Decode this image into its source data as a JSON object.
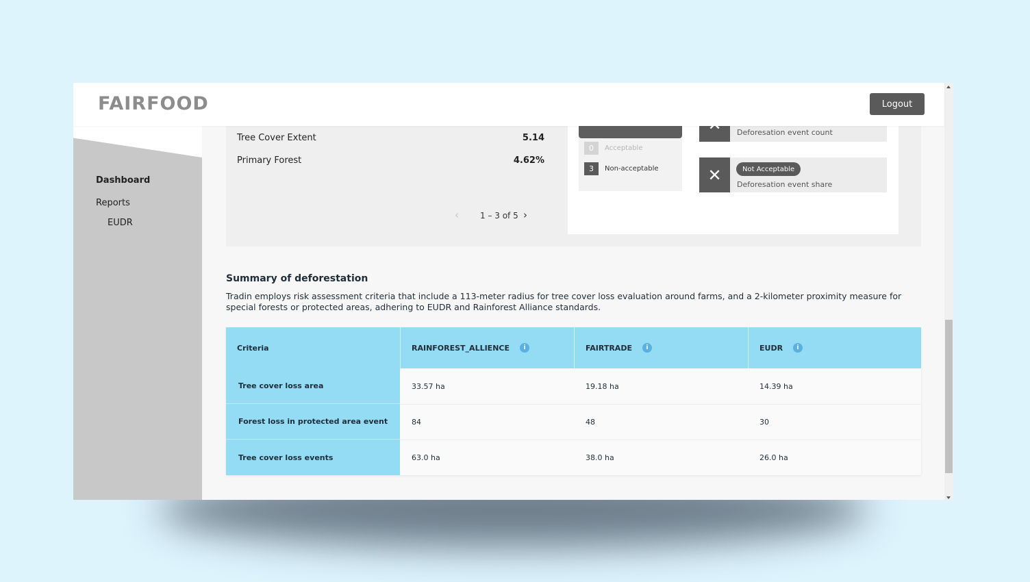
{
  "header": {
    "logo": "FAIRFOOD",
    "logout_label": "Logout"
  },
  "sidebar": {
    "items": [
      {
        "label": "Dashboard"
      },
      {
        "label": "Reports"
      },
      {
        "label": "EUDR"
      }
    ]
  },
  "metrics": [
    {
      "label": "Tree Cover Extent",
      "value": "5.14"
    },
    {
      "label": "Primary Forest",
      "value": "4.62%"
    }
  ],
  "pager": {
    "text": "1 – 3 of 5",
    "prev": "‹",
    "next": "›"
  },
  "legend": [
    {
      "count": "0",
      "label": "Acceptable",
      "color": "#d4d4d4"
    },
    {
      "count": "3",
      "label": "Non-acceptable",
      "color": "#5a5a5a"
    }
  ],
  "risk_cards": [
    {
      "badge": "",
      "label": "Deforesation event count"
    },
    {
      "badge": "Not Acceptable",
      "label": "Deforesation event share"
    }
  ],
  "summary": {
    "title": "Summary of deforestation",
    "description": "Tradin employs risk assessment criteria that include a 113-meter radius for tree cover loss evaluation around farms, and a 2-kilometer proximity measure for special forests or protected areas, adhering to EUDR and Rainforest Alliance standards."
  },
  "table": {
    "headers": [
      "Criteria",
      "RAINFOREST_ALLIENCE",
      "FAIRTRADE",
      "EUDR"
    ],
    "rows": [
      [
        "Tree cover loss area",
        "33.57 ha",
        "19.18 ha",
        "14.39 ha"
      ],
      [
        "Forest loss in protected area event",
        "84",
        "48",
        "30"
      ],
      [
        "Tree cover loss events",
        "63.0 ha",
        "38.0 ha",
        "26.0 ha"
      ]
    ]
  },
  "colors": {
    "accent": "#93dcf4",
    "info": "#5ab0e0",
    "dark": "#5a5a5a"
  }
}
